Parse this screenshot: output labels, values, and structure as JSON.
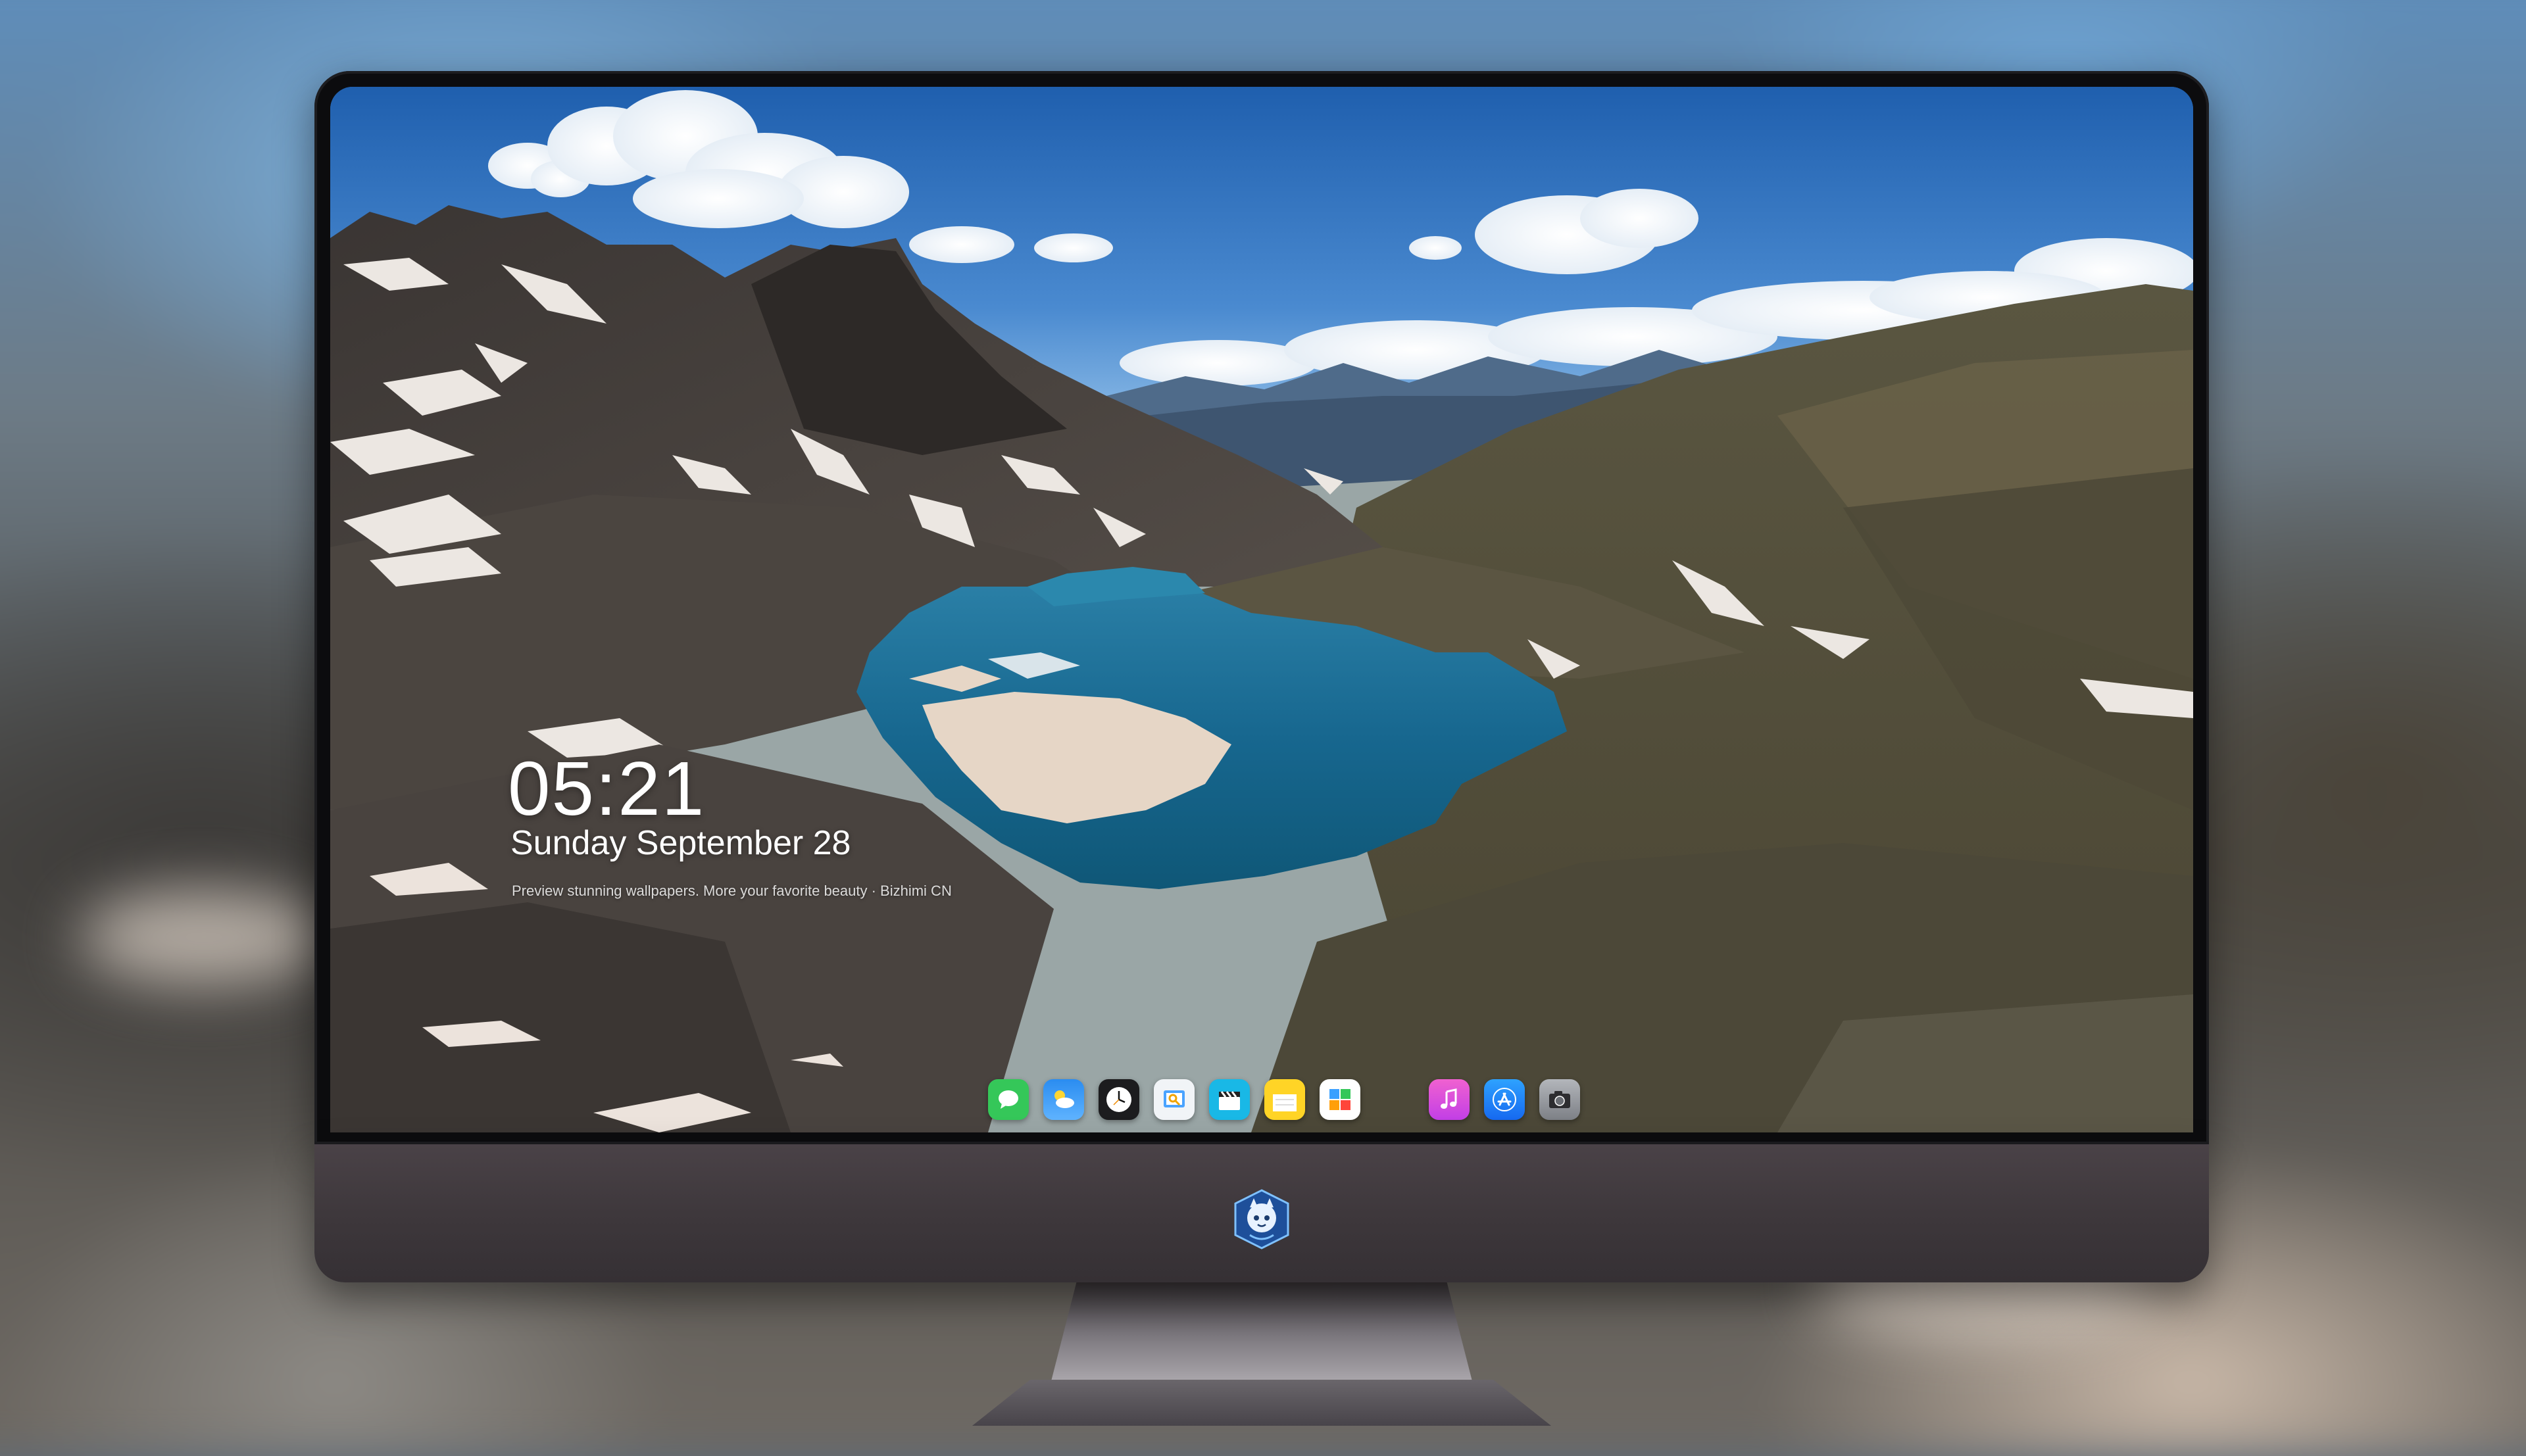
{
  "lockscreen": {
    "time": "05:21",
    "date": "Sunday September 28",
    "caption": "Preview stunning wallpapers. More your favorite beauty · Bizhimi CN"
  },
  "dock": {
    "apps": [
      {
        "name": "Messages",
        "icon": "messages-icon",
        "color": "#35c759"
      },
      {
        "name": "Weather",
        "icon": "weather-icon",
        "color": "#2f8cf0"
      },
      {
        "name": "Clock",
        "icon": "clock-icon",
        "color": "#1c1c1e"
      },
      {
        "name": "Preview",
        "icon": "preview-icon",
        "color": "#f1f4f7"
      },
      {
        "name": "Clips",
        "icon": "clapperboard-icon",
        "color": "#19b8e6"
      },
      {
        "name": "Notes",
        "icon": "notes-icon",
        "color": "#ffd426"
      },
      {
        "name": "Photos Calendar",
        "icon": "calendar-grid-icon",
        "color": "#ffffff"
      },
      {
        "name": "iTunes",
        "icon": "music-icon",
        "color": "#e24bd9"
      },
      {
        "name": "App Store",
        "icon": "app-store-icon",
        "color": "#1e8ef5"
      },
      {
        "name": "Camera",
        "icon": "camera-icon",
        "color": "#8d8f94"
      }
    ]
  },
  "colors": {
    "sky": "#2a6bb5",
    "lake": "#1e6f95",
    "monitor_chin": "#3f393d"
  }
}
